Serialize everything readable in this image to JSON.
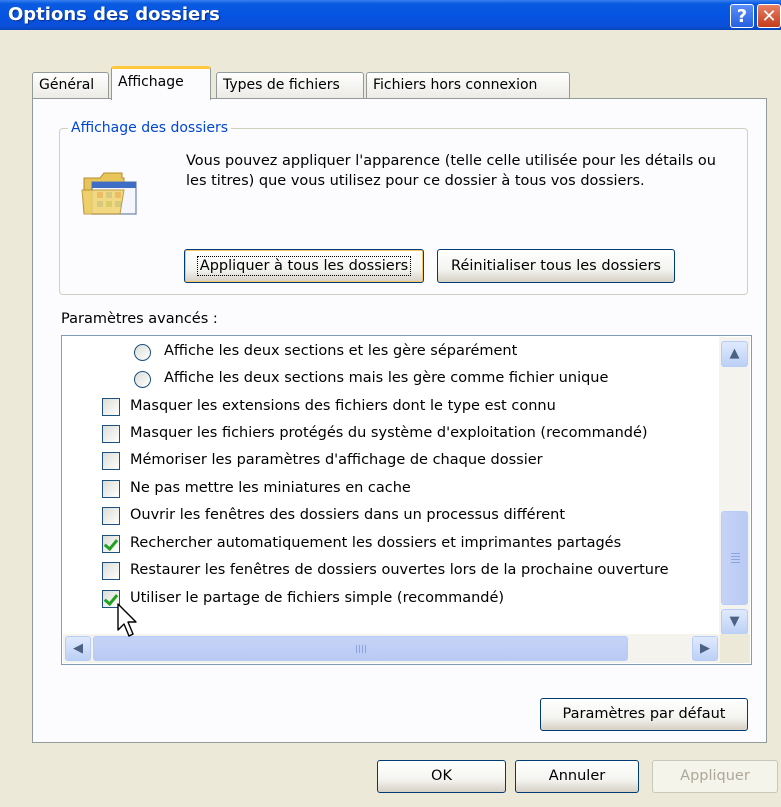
{
  "window": {
    "title": "Options des dossiers",
    "help_label": "?",
    "close_label": "✕"
  },
  "tabs": [
    {
      "label": "Général",
      "active": false
    },
    {
      "label": "Affichage",
      "active": true
    },
    {
      "label": "Types de fichiers",
      "active": false
    },
    {
      "label": "Fichiers hors connexion",
      "active": false
    }
  ],
  "folder_view": {
    "legend": "Affichage des dossiers",
    "description": "Vous pouvez appliquer l'apparence (telle celle utilisée pour les détails ou les titres) que vous utilisez pour ce dossier à tous vos dossiers.",
    "icon": "folder-options-icon",
    "apply_all_label": "Appliquer à tous les dossiers",
    "reset_all_label": "Réinitialiser tous les dossiers"
  },
  "advanced": {
    "label": "Paramètres avancés :",
    "items": [
      {
        "type": "radio",
        "checked": false,
        "label": "Affiche les deux sections et les gère séparément"
      },
      {
        "type": "radio",
        "checked": false,
        "label": "Affiche les deux sections mais les gère comme fichier unique"
      },
      {
        "type": "checkbox",
        "checked": false,
        "label": "Masquer les extensions des fichiers dont le type est connu"
      },
      {
        "type": "checkbox",
        "checked": false,
        "label": "Masquer les fichiers protégés du système d'exploitation (recommandé)"
      },
      {
        "type": "checkbox",
        "checked": false,
        "label": "Mémoriser les paramètres d'affichage de chaque dossier"
      },
      {
        "type": "checkbox",
        "checked": false,
        "label": "Ne pas mettre les miniatures en cache"
      },
      {
        "type": "checkbox",
        "checked": false,
        "label": "Ouvrir les fenêtres des dossiers dans un processus différent"
      },
      {
        "type": "checkbox",
        "checked": true,
        "label": "Rechercher automatiquement les dossiers et imprimantes partagés"
      },
      {
        "type": "checkbox",
        "checked": false,
        "label": "Restaurer les fenêtres de dossiers ouvertes lors de la prochaine ouverture"
      },
      {
        "type": "checkbox",
        "checked": true,
        "label": "Utiliser le partage de fichiers simple (recommandé)"
      }
    ]
  },
  "buttons": {
    "defaults_label": "Paramètres par défaut",
    "ok_label": "OK",
    "cancel_label": "Annuler",
    "apply_label": "Appliquer",
    "apply_enabled": false
  },
  "colors": {
    "accent": "#0054E3",
    "legend_text": "#0046D5",
    "check_mark": "#21A121",
    "active_tab_highlight": "#FFC83C"
  }
}
